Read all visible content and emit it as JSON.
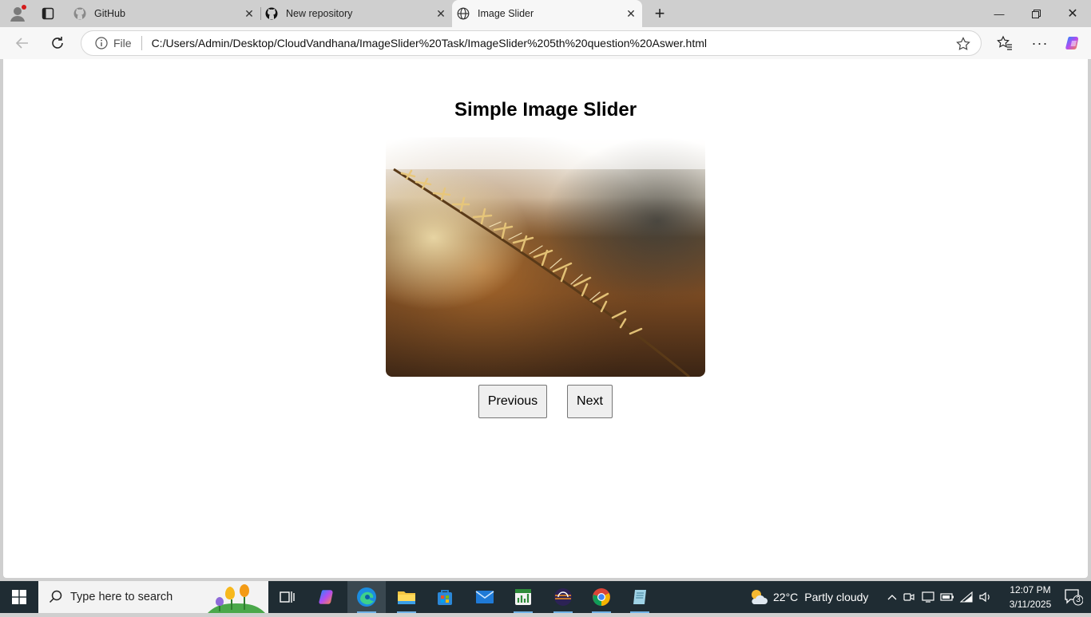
{
  "browser": {
    "tabs": [
      {
        "label": "GitHub",
        "icon": "github-icon"
      },
      {
        "label": "New repository",
        "icon": "github-icon"
      },
      {
        "label": "Image Slider",
        "icon": "globe-icon"
      }
    ],
    "address": {
      "prefix": "File",
      "url": "C:/Users/Admin/Desktop/CloudVandhana/ImageSlider%20Task/ImageSlider%205th%20question%20Aswer.html"
    }
  },
  "page": {
    "title": "Simple Image Slider",
    "image_alt": "Golden grass seed head against blurred background",
    "prev_label": "Previous",
    "next_label": "Next"
  },
  "taskbar": {
    "search_placeholder": "Type here to search",
    "weather": {
      "temp": "22°C",
      "condition": "Partly cloudy"
    },
    "time": "12:07 PM",
    "date": "3/11/2025",
    "notification_count": "3"
  },
  "colors": {
    "taskbar_bg": "#1f2c33",
    "tabbar_bg": "#cfcfcf",
    "active_tab_bg": "#f7f7f7"
  }
}
